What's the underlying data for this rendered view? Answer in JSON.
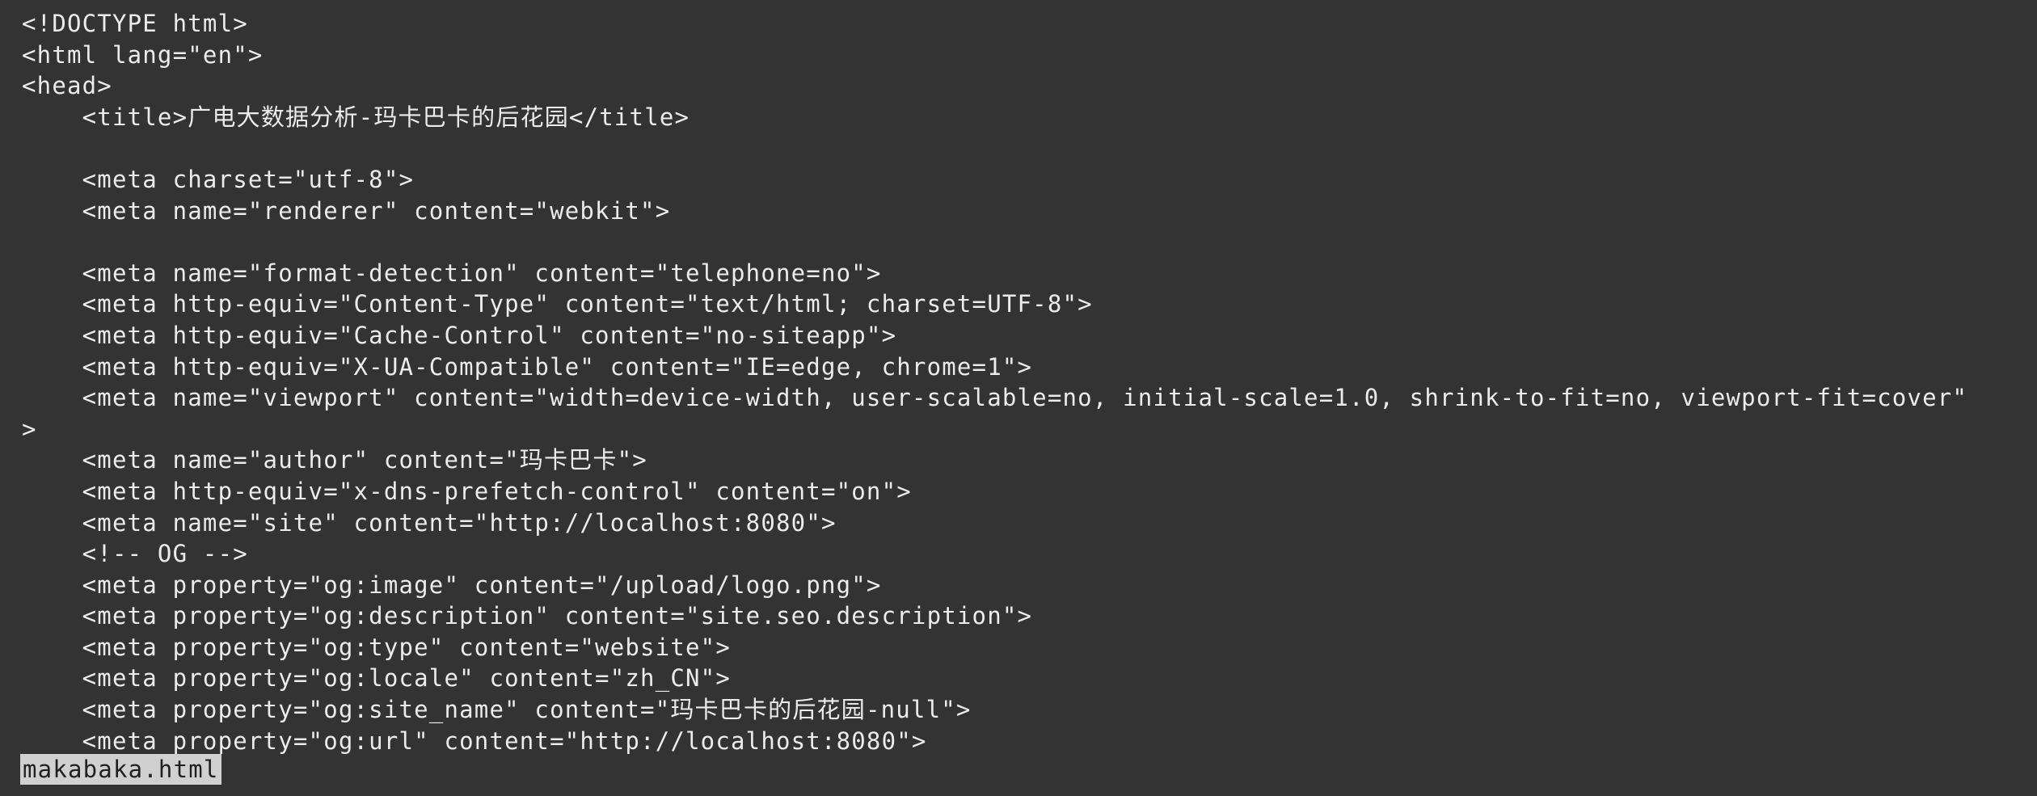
{
  "file": {
    "name": "makabaka.html"
  },
  "code_lines": [
    "<!DOCTYPE html>",
    "<html lang=\"en\">",
    "<head>",
    "    <title>广电大数据分析-玛卡巴卡的后花园</title>",
    "",
    "    <meta charset=\"utf-8\">",
    "    <meta name=\"renderer\" content=\"webkit\">",
    "",
    "    <meta name=\"format-detection\" content=\"telephone=no\">",
    "    <meta http-equiv=\"Content-Type\" content=\"text/html; charset=UTF-8\">",
    "    <meta http-equiv=\"Cache-Control\" content=\"no-siteapp\">",
    "    <meta http-equiv=\"X-UA-Compatible\" content=\"IE=edge, chrome=1\">",
    "    <meta name=\"viewport\" content=\"width=device-width, user-scalable=no, initial-scale=1.0, shrink-to-fit=no, viewport-fit=cover\"",
    ">",
    "    <meta name=\"author\" content=\"玛卡巴卡\">",
    "    <meta http-equiv=\"x-dns-prefetch-control\" content=\"on\">",
    "    <meta name=\"site\" content=\"http://localhost:8080\">",
    "    <!-- OG -->",
    "    <meta property=\"og:image\" content=\"/upload/logo.png\">",
    "    <meta property=\"og:description\" content=\"site.seo.description\">",
    "    <meta property=\"og:type\" content=\"website\">",
    "    <meta property=\"og:locale\" content=\"zh_CN\">",
    "    <meta property=\"og:site_name\" content=\"玛卡巴卡的后花园-null\">",
    "    <meta property=\"og:url\" content=\"http://localhost:8080\">"
  ]
}
